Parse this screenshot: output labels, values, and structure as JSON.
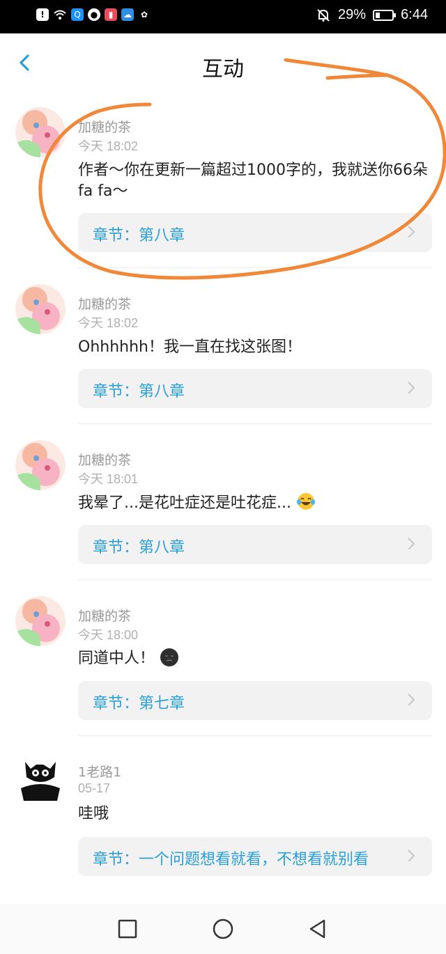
{
  "status_bar": {
    "battery": "29%",
    "time": "6:44",
    "battery_level": 0.29,
    "left_icons": [
      "alert-icon",
      "wifi-icon",
      "search-app-icon",
      "basketball-app-icon",
      "book-app-icon",
      "cloud-app-icon",
      "wechat-icon"
    ],
    "right_icons": [
      "mute-bell-icon",
      "battery-icon"
    ]
  },
  "header": {
    "title": "互动",
    "back_icon": "chevron-left-icon"
  },
  "colors": {
    "accent": "#2a9fd8",
    "annotation": "#f0883a",
    "chapter_bg": "#f2f2f2"
  },
  "comments": [
    {
      "username": "加糖的茶",
      "time": "今天 18:02",
      "content": "作者～你在更新一篇超过1000字的，我就送你66朵fa fa～",
      "chapter": "章节：第八章"
    },
    {
      "username": "加糖的茶",
      "time": "今天 18:02",
      "content": "Ohhhhhh！我一直在找这张图！",
      "chapter": "章节：第八章"
    },
    {
      "username": "加糖的茶",
      "time": "今天 18:01",
      "content": "我晕了...是花吐症还是吐花症...",
      "chapter": "章节：第八章",
      "emoji": "laughing-tears-emoji"
    },
    {
      "username": "加糖的茶",
      "time": "今天 18:00",
      "content": "同道中人！",
      "chapter": "章节：第七章",
      "emoji": "dark-face-emoji"
    },
    {
      "username": "1老路1",
      "time": "05-17",
      "content": "哇哦",
      "chapter": "章节：一个问题想看就看，不想看就别看"
    }
  ],
  "nav_bar": {
    "icons": [
      "recents-square-icon",
      "home-circle-icon",
      "back-triangle-icon"
    ]
  }
}
